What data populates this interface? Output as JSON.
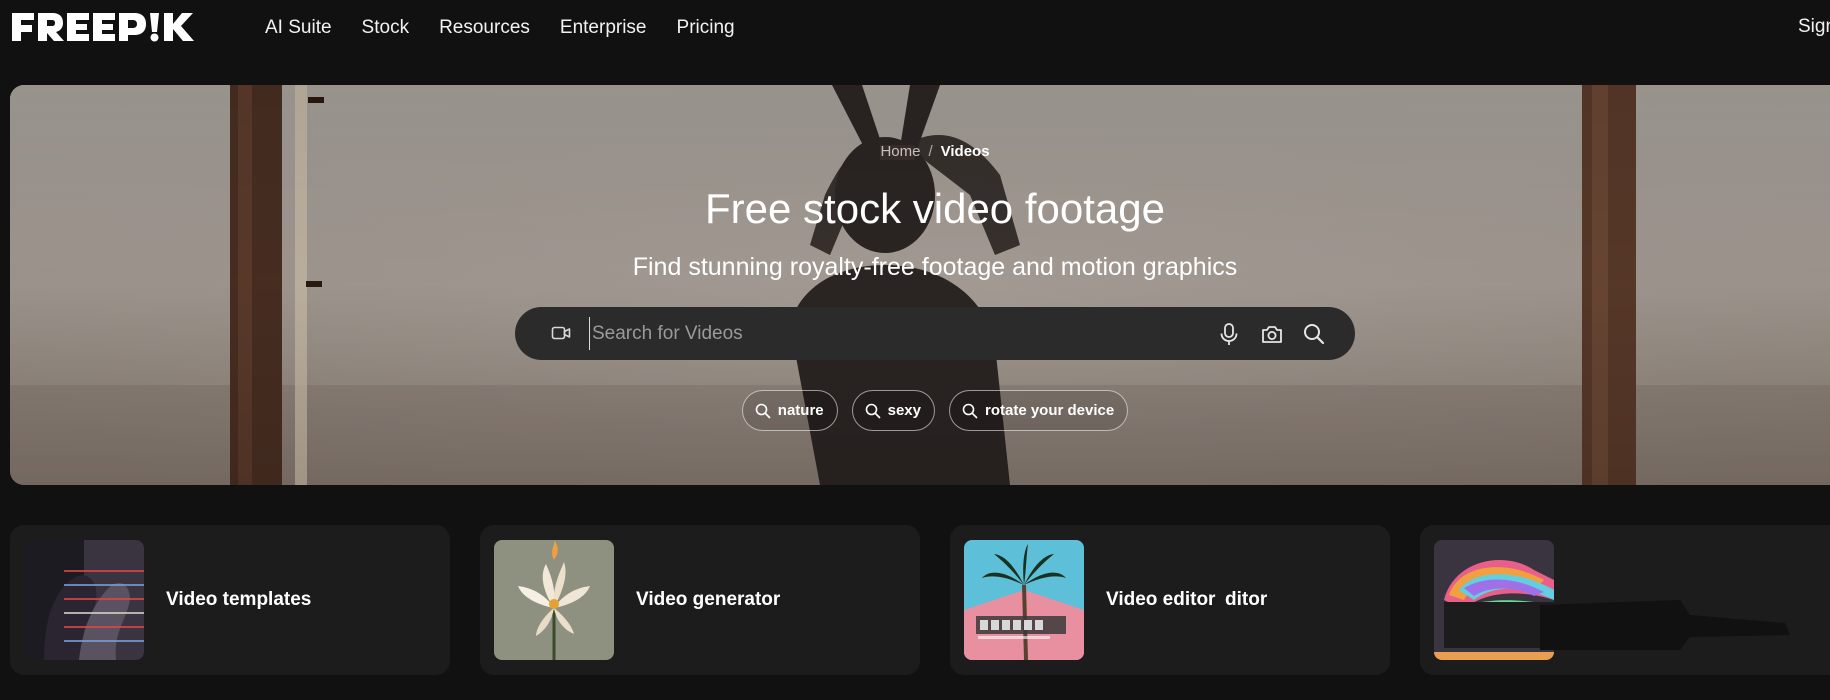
{
  "brand": {
    "logo_text": "FREEPIK"
  },
  "nav": {
    "items": [
      {
        "label": "AI Suite"
      },
      {
        "label": "Stock"
      },
      {
        "label": "Resources"
      },
      {
        "label": "Enterprise"
      },
      {
        "label": "Pricing"
      }
    ],
    "signin_label": "Sign"
  },
  "hero": {
    "breadcrumb": {
      "home": "Home",
      "separator": "/",
      "current": "Videos"
    },
    "title": "Free stock video footage",
    "subtitle": "Find stunning royalty-free footage and motion graphics",
    "search": {
      "placeholder": "Search for Videos",
      "value": "",
      "type_icon": "video-icon",
      "icons": [
        "microphone-icon",
        "camera-icon",
        "search-icon"
      ]
    },
    "suggestions": [
      {
        "label": "nature"
      },
      {
        "label": "sexy"
      },
      {
        "label": "rotate your device"
      }
    ]
  },
  "cards": [
    {
      "label": "Video templates"
    },
    {
      "label": "Video generator"
    },
    {
      "label": "Video editor",
      "extra": "ditor"
    },
    {
      "label": ""
    }
  ],
  "colors": {
    "background": "#111111",
    "card_bg": "#1c1c1c",
    "search_bg": "#2b2b2b",
    "text": "#ffffff",
    "placeholder": "#9a9a9a"
  }
}
